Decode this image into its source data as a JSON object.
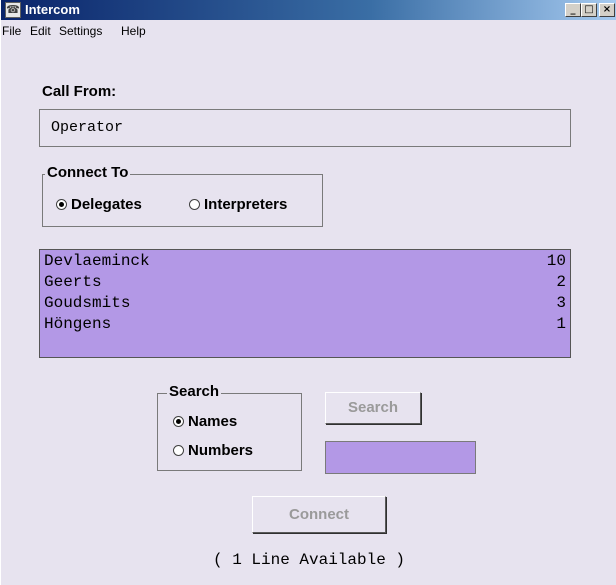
{
  "window": {
    "title": "Intercom",
    "controls": {
      "minimize": "_",
      "maximize": "□",
      "close": "×"
    }
  },
  "menu": [
    "File",
    "Edit",
    "Settings",
    "Help"
  ],
  "call_from": {
    "label": "Call From:",
    "value": "Operator"
  },
  "connect_to": {
    "title": "Connect To",
    "options": [
      {
        "label": "Delegates",
        "selected": true
      },
      {
        "label": "Interpreters",
        "selected": false
      }
    ]
  },
  "list": {
    "background": "#b398e6",
    "items": [
      {
        "name": "Devlaeminck",
        "count": "10"
      },
      {
        "name": "Geerts",
        "count": "2"
      },
      {
        "name": "Goudsmits",
        "count": "3"
      },
      {
        "name": "Höngens",
        "count": "1"
      }
    ]
  },
  "search": {
    "title": "Search",
    "options": [
      {
        "label": "Names",
        "selected": true
      },
      {
        "label": "Numbers",
        "selected": false
      }
    ],
    "button_label": "Search",
    "input_value": ""
  },
  "connect_button": "Connect",
  "status": "( 1 Line Available )"
}
